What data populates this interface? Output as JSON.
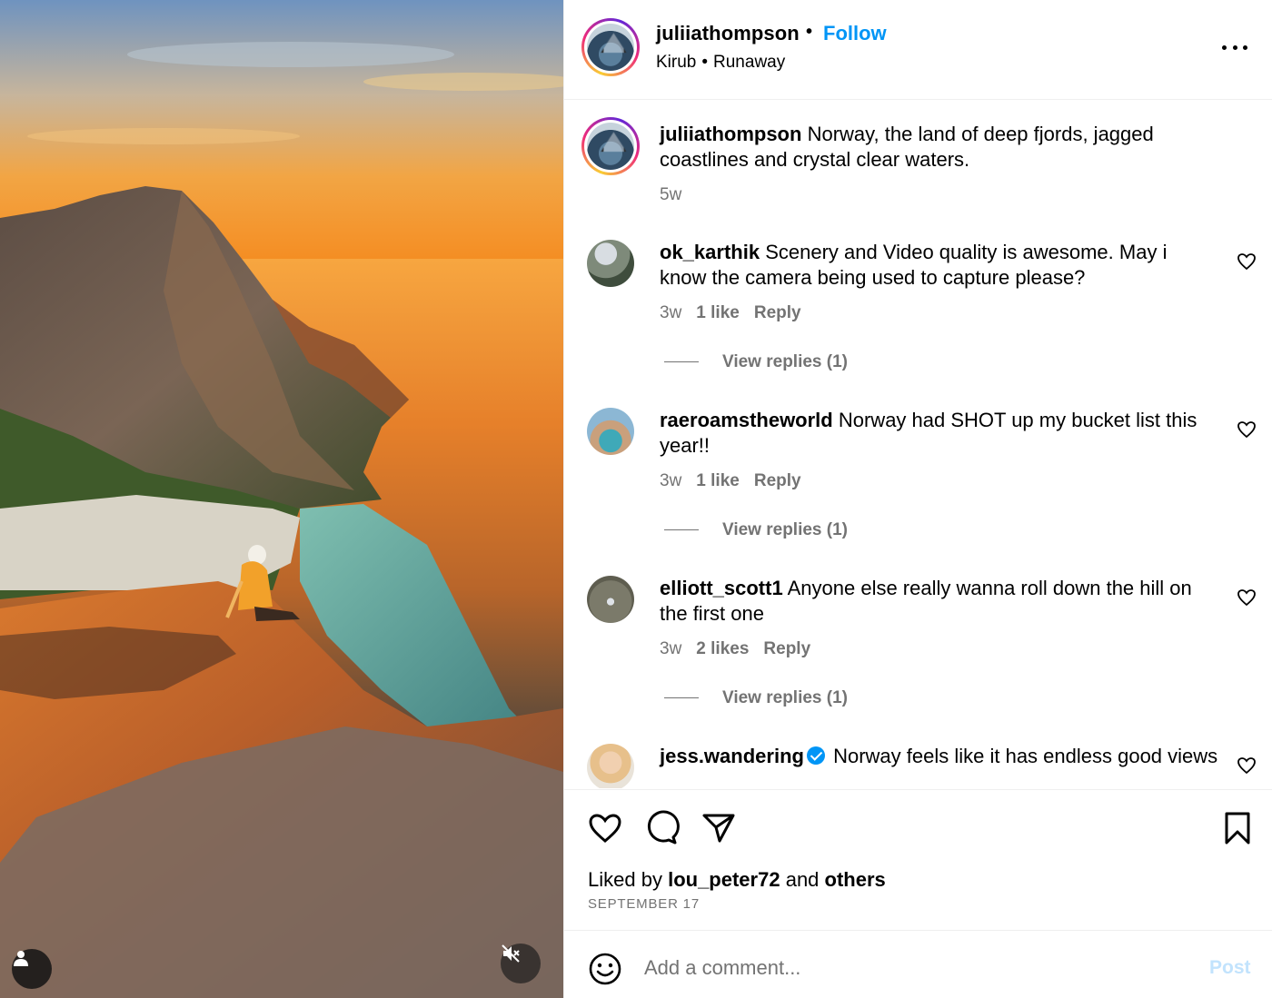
{
  "post": {
    "owner": "juliiathompson",
    "follow_label": "Follow",
    "separator": "•",
    "audio_artist": "Kirub",
    "audio_track": "Runaway"
  },
  "caption": {
    "username": "juliiathompson",
    "text": "Norway, the land of deep fjords, jagged coastlines and crystal clear waters.",
    "time": "5w"
  },
  "comments": [
    {
      "username": "ok_karthik",
      "text": "Scenery and Video quality is awesome. May i know the camera being used to capture please?",
      "time": "3w",
      "likes": "1 like",
      "reply_label": "Reply",
      "view_replies": "View replies (1)"
    },
    {
      "username": "raeroamstheworld",
      "text": "Norway had SHOT up my bucket list this year!!",
      "time": "3w",
      "likes": "1 like",
      "reply_label": "Reply",
      "view_replies": "View replies (1)"
    },
    {
      "username": "elliott_scott1",
      "text": "Anyone else really wanna roll down the hill on the first one",
      "time": "3w",
      "likes": "2 likes",
      "reply_label": "Reply",
      "view_replies": "View replies (1)"
    },
    {
      "username": "jess.wandering",
      "verified": true,
      "text": "Norway feels like it has endless good views"
    }
  ],
  "likes": {
    "prefix": "Liked by",
    "user": "lou_peter72",
    "middle": "and",
    "others": "others"
  },
  "date": "SEPTEMBER 17",
  "add_comment": {
    "placeholder": "Add a comment...",
    "post_label": "Post"
  },
  "colors": {
    "accent": "#0095f6",
    "muted": "#737373",
    "post_disabled": "#c2e3fd"
  },
  "icons": [
    "user-tag-icon",
    "mute-icon",
    "more-icon",
    "heart-icon",
    "comment-icon",
    "share-icon",
    "bookmark-icon",
    "emoji-icon",
    "verified-badge-icon"
  ]
}
